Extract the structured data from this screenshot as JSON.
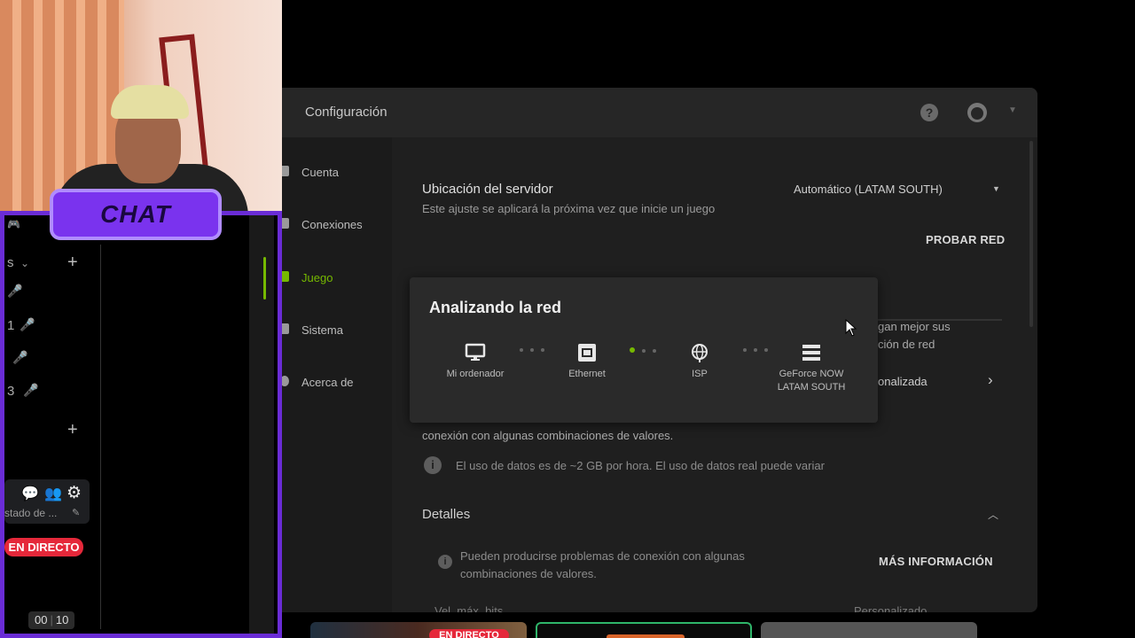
{
  "window": {
    "title": "Configuración",
    "help_glyph": "?"
  },
  "nav": {
    "items": [
      {
        "label": "Cuenta"
      },
      {
        "label": "Conexiones"
      },
      {
        "label": "Juego",
        "active": true
      },
      {
        "label": "Sistema"
      },
      {
        "label": "Acerca de"
      }
    ]
  },
  "settings": {
    "server_location": {
      "label": "Ubicación del servidor",
      "hint": "Este ajuste se aplicará la próxima vez que inicie un juego",
      "value": "Automático (LATAM SOUTH)"
    },
    "test_network_button": "PROBAR RED",
    "partial_line1": "gan mejor sus",
    "partial_line2": "ción de red",
    "partial_custom": "onalizada",
    "conn_warning": "conexión con algunas combinaciones de valores.",
    "data_usage_note": "El uso de datos es de ~2 GB por hora. El uso de datos real puede variar",
    "details": {
      "label": "Detalles",
      "warning": "Pueden producirse problemas de conexión con algunas combinaciones de valores.",
      "more_info_button": "MÁS INFORMACIÓN"
    },
    "max_bitrate_label": "Vel. máx. bits",
    "max_bitrate_value": "Personalizado"
  },
  "network_dialog": {
    "title": "Analizando la red",
    "nodes": [
      {
        "label": "Mi ordenador",
        "icon": "monitor-icon"
      },
      {
        "label": "Ethernet",
        "icon": "ethernet-icon"
      },
      {
        "label": "ISP",
        "icon": "globe-icon"
      },
      {
        "label": "GeForce NOW\nLATAM SOUTH",
        "icon": "server-icon"
      }
    ]
  },
  "overlay": {
    "chat_title": "CHAT",
    "channel_frag": "s",
    "user_suffix_1": "1",
    "user_suffix_3": "3",
    "status_text": "stado de ...",
    "live_badge": "EN DIRECTO",
    "counter_left": "00",
    "counter_right": "10",
    "thumb_live": "EN DIRECTO"
  },
  "colors": {
    "accent": "#76b900",
    "overlay_purple": "#6a2cd6",
    "live_red": "#e5283a"
  }
}
